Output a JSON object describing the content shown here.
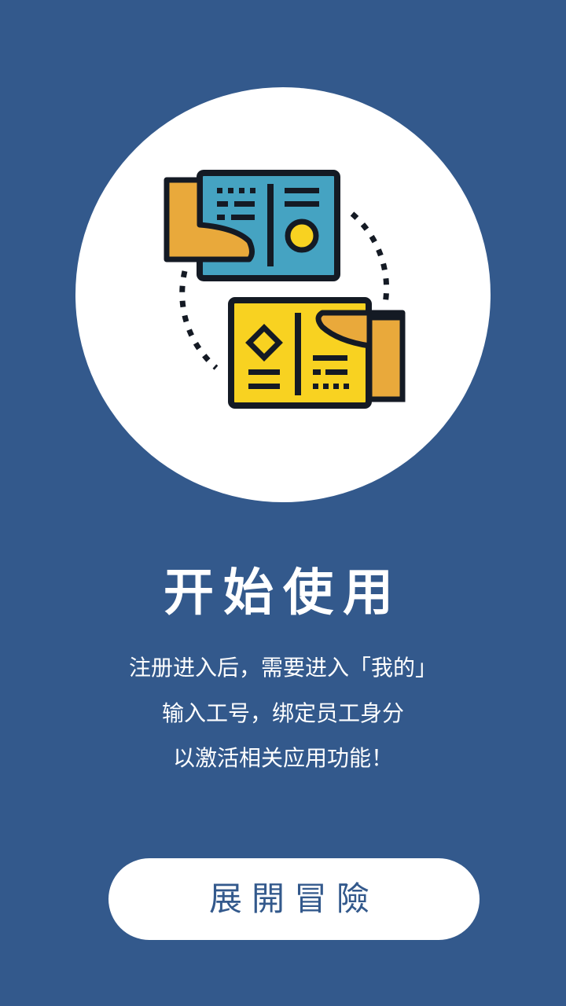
{
  "onboarding": {
    "title": "开始使用",
    "description_lines": [
      "注册进入后，需要进入「我的」",
      "输入工号，绑定员工身分",
      "以激活相关应用功能！"
    ],
    "button_label": "展開冒險"
  },
  "colors": {
    "background": "#33598C",
    "circle": "#FFFFFF",
    "card_blue": "#45A3C2",
    "card_yellow": "#F8D221",
    "hand": "#E9A93B",
    "outline": "#141A24",
    "button_text": "#33598C"
  },
  "icons": {
    "illustration": "card-exchange-icon"
  }
}
